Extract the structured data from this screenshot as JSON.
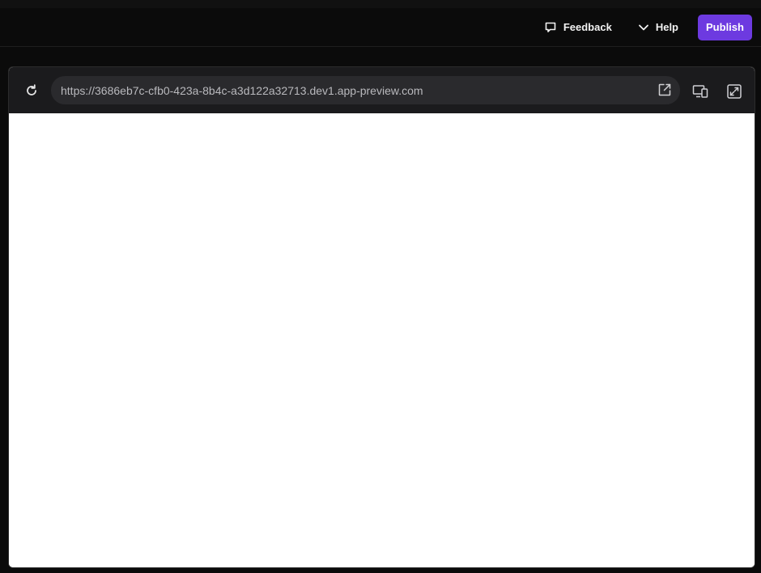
{
  "header": {
    "feedback_label": "Feedback",
    "feedback_icon": "chat-bubble-icon",
    "help_label": "Help",
    "help_icon": "chevron-down-icon",
    "publish_label": "Publish",
    "publish_color": "#6d3ae0"
  },
  "preview": {
    "reload_icon": "reload-icon",
    "url": "https://3686eb7c-cfb0-423a-8b4c-a3d122a32713.dev1.app-preview.com",
    "open_external_icon": "external-link-icon",
    "device_icon": "responsive-devices-icon",
    "expand_icon": "expand-icon"
  }
}
